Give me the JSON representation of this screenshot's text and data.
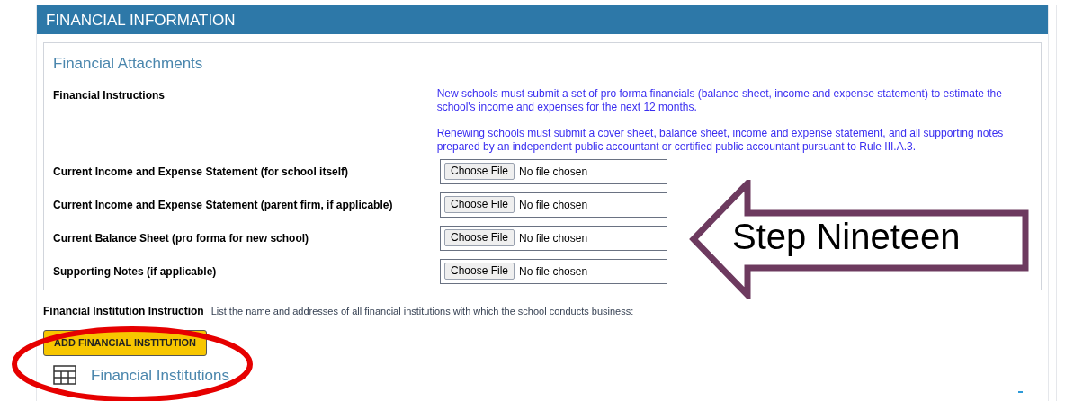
{
  "panel": {
    "title": "FINANCIAL INFORMATION"
  },
  "attachments": {
    "title": "Financial Attachments",
    "instructions_label": "Financial Instructions",
    "instructions": [
      "New schools must submit a set of pro forma financials (balance sheet, income and expense statement) to estimate the school's income and expenses for the next 12 months.",
      "Renewing schools must submit a cover sheet, balance sheet, income and expense statement, and all supporting notes prepared by an independent public accountant or certified public accountant pursuant to Rule III.A.3."
    ],
    "files": [
      {
        "label": "Current Income and Expense Statement (for school itself)",
        "button": "Choose File",
        "status": "No file chosen"
      },
      {
        "label": "Current Income and Expense Statement (parent firm, if applicable)",
        "button": "Choose File",
        "status": "No file chosen"
      },
      {
        "label": "Current Balance Sheet (pro forma for new school)",
        "button": "Choose File",
        "status": "No file chosen"
      },
      {
        "label": "Supporting Notes (if applicable)",
        "button": "Choose File",
        "status": "No file chosen"
      }
    ]
  },
  "institution_instruction": {
    "label": "Financial Institution Instruction",
    "text": "List the name and addresses of all financial institutions with which the school conducts business:"
  },
  "add_button": "ADD FINANCIAL INSTITUTION",
  "institutions": {
    "title": "Financial Institutions"
  },
  "annotation": {
    "arrow_text": "Step Nineteen"
  }
}
